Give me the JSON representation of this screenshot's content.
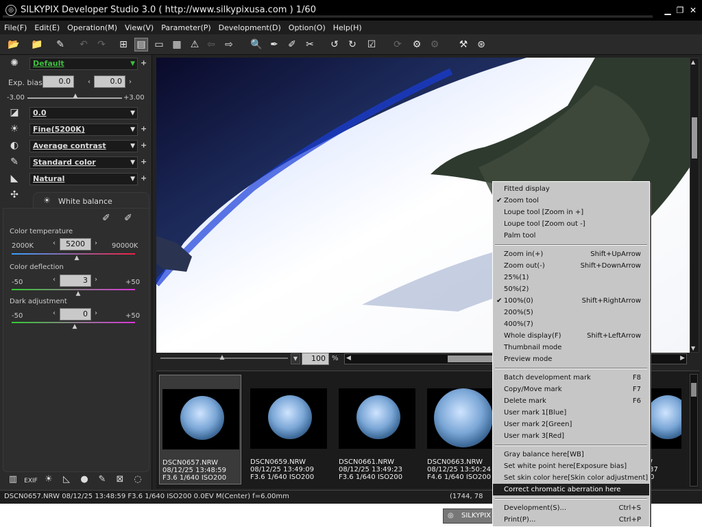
{
  "window": {
    "title": "SILKYPIX Developer Studio 3.0 ( http://www.silkypixusa.com )   1/60",
    "minimize_icon": "minimize-icon",
    "restore_icon": "restore-icon",
    "close_icon": "close-icon"
  },
  "menu": [
    "File(F)",
    "Edit(E)",
    "Operation(M)",
    "View(V)",
    "Parameter(P)",
    "Development(D)",
    "Option(O)",
    "Help(H)"
  ],
  "left_panel": {
    "taste": "Default",
    "exp_bias_label": "Exp. bias",
    "exp_bias_value": "0.0",
    "exp_bias_value2": "0.0",
    "exp_min": "-3.00",
    "exp_max": "+3.00",
    "exp_level": 0.0,
    "tone_curve": "0.0",
    "white_balance_preset": "Fine(5200K)",
    "contrast": "Average contrast",
    "color": "Standard color",
    "sharpness": "Natural",
    "subpanel_title": "White balance",
    "color_temperature_label": "Color temperature",
    "ct_min": "2000K",
    "ct_value": "5200",
    "ct_max": "90000K",
    "ct_level": 0.36,
    "color_deflection_label": "Color deflection",
    "cd_min": "-50",
    "cd_value": "3",
    "cd_max": "+50",
    "dark_adjust_label": "Dark adjustment",
    "da_min": "-50",
    "da_value": "0",
    "da_max": "+50"
  },
  "zoom": {
    "value": "100",
    "unit": "%"
  },
  "thumbnails": [
    {
      "name": "DSCN0657.NRW",
      "date": "08/12/25 13:48:59",
      "exposure": "F3.6 1/640 ISO200",
      "selected": true
    },
    {
      "name": "DSCN0659.NRW",
      "date": "08/12/25 13:49:09",
      "exposure": "F3.6 1/640 ISO200",
      "selected": false
    },
    {
      "name": "DSCN0661.NRW",
      "date": "08/12/25 13:49:23",
      "exposure": "F3.6 1/640 ISO200",
      "selected": false
    },
    {
      "name": "DSCN0663.NRW",
      "date": "08/12/25 13:50:24",
      "exposure": "F4.6 1/640 ISO200",
      "selected": false
    },
    {
      "name": "W",
      "date": ".37",
      "exposure": "0",
      "selected": false
    }
  ],
  "status": {
    "left": "DSCN0657.NRW 08/12/25 13:48:59 F3.6 1/640 ISO200 0.0EV M(Center) f=6.00mm",
    "coords": "(1744, 78"
  },
  "taskbar": {
    "button": "SILKYPIX"
  },
  "context_menu": [
    {
      "label": "Fitted display",
      "shortcut": ""
    },
    {
      "label": "Zoom tool",
      "shortcut": "",
      "checked": true
    },
    {
      "label": "Loupe tool [Zoom in +]",
      "shortcut": ""
    },
    {
      "label": "Loupe tool [Zoom out -]",
      "shortcut": ""
    },
    {
      "label": "Palm tool",
      "shortcut": ""
    },
    {
      "sep": true
    },
    {
      "label": "Zoom in(+)",
      "shortcut": "Shift+UpArrow"
    },
    {
      "label": "Zoom out(-)",
      "shortcut": "Shift+DownArrow"
    },
    {
      "label": "25%(1)",
      "shortcut": ""
    },
    {
      "label": "50%(2)",
      "shortcut": ""
    },
    {
      "label": "100%(0)",
      "shortcut": "Shift+RightArrow",
      "checked": true
    },
    {
      "label": "200%(5)",
      "shortcut": ""
    },
    {
      "label": "400%(7)",
      "shortcut": ""
    },
    {
      "label": "Whole display(F)",
      "shortcut": "Shift+LeftArrow"
    },
    {
      "label": "Thumbnail mode",
      "shortcut": ""
    },
    {
      "label": "Preview mode",
      "shortcut": ""
    },
    {
      "sep": true
    },
    {
      "label": "Batch development mark",
      "shortcut": "F8"
    },
    {
      "label": "Copy/Move mark",
      "shortcut": "F7"
    },
    {
      "label": "Delete mark",
      "shortcut": "F6"
    },
    {
      "label": "User mark 1[Blue]",
      "shortcut": ""
    },
    {
      "label": "User mark 2[Green]",
      "shortcut": ""
    },
    {
      "label": "User mark 3[Red]",
      "shortcut": ""
    },
    {
      "sep": true
    },
    {
      "label": "Gray balance here[WB]",
      "shortcut": ""
    },
    {
      "label": "Set white point here[Exposure bias]",
      "shortcut": ""
    },
    {
      "label": "Set skin color here[Skin color adjustment]",
      "shortcut": ""
    },
    {
      "label": "Correct chromatic aberration here",
      "shortcut": "",
      "highlighted": true
    },
    {
      "sep": true
    },
    {
      "label": "Development(S)...",
      "shortcut": "Ctrl+S"
    },
    {
      "label": "Print(P)...",
      "shortcut": "Ctrl+P"
    }
  ]
}
